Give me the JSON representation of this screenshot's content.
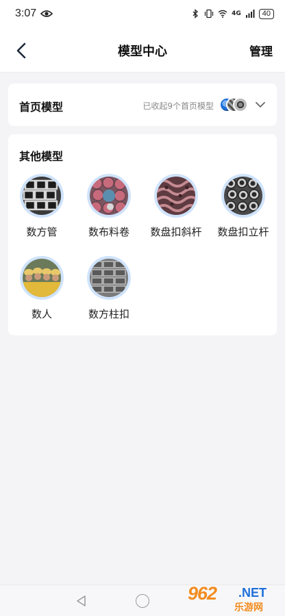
{
  "status_bar": {
    "time": "3:07",
    "network_label": "4G",
    "battery": "40"
  },
  "nav": {
    "title": "模型中心",
    "manage_label": "管理"
  },
  "home_models": {
    "title": "首页模型",
    "summary": "已收起9个首页模型"
  },
  "other_models": {
    "title": "其他模型",
    "items": [
      {
        "label": "数方管",
        "icon": "square-tube-image"
      },
      {
        "label": "数布料卷",
        "icon": "fabric-roll-image"
      },
      {
        "label": "数盘扣斜杆",
        "icon": "disc-buckle-diagonal-image"
      },
      {
        "label": "数盘扣立杆",
        "icon": "disc-buckle-pole-image"
      },
      {
        "label": "数人",
        "icon": "people-image"
      },
      {
        "label": "数方柱扣",
        "icon": "square-column-clip-image"
      }
    ]
  },
  "watermark": {
    "brand": "962",
    "domain": ".NET",
    "subtitle": "乐游网"
  },
  "colors": {
    "background": "#f4f4f6",
    "card": "#ffffff",
    "avatar_ring": "#cfe3fb",
    "accent_blue": "#1e6fd9",
    "watermark_orange": "#f28c1f"
  }
}
